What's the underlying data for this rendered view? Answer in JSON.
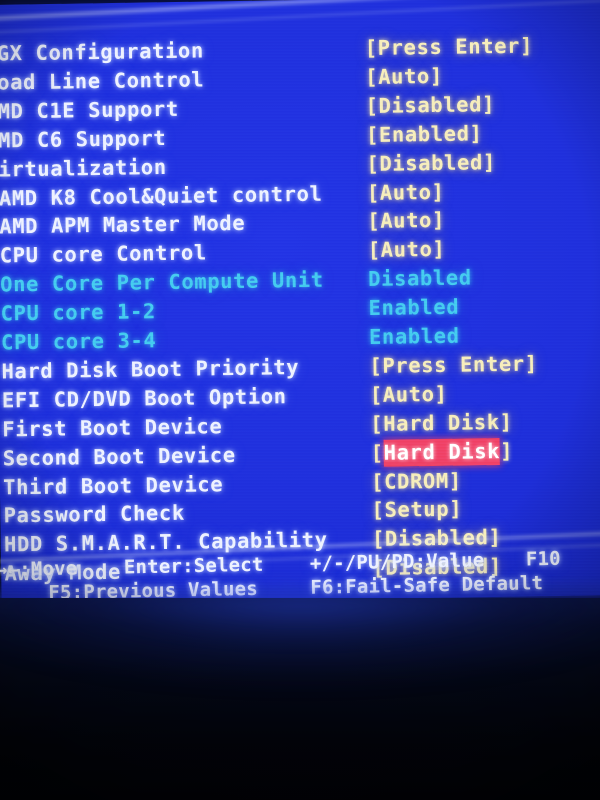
{
  "screen": {
    "kind": "bios-setup-screen",
    "background_color": "#1f2fdd",
    "text_color": "#eef2ff",
    "value_color": "#f7eebe",
    "disabled_color": "#46cdf0",
    "highlight_bg": "#f0436a",
    "highlight_fg": "#ffffff"
  },
  "menu": {
    "rows": [
      {
        "label": "GX Configuration",
        "value": "[Press Enter]",
        "state": "normal"
      },
      {
        "label": "oad Line Control",
        "value": "[Auto]",
        "state": "normal"
      },
      {
        "label": "MD C1E Support",
        "value": "[Disabled]",
        "state": "normal"
      },
      {
        "label": "MD C6 Support",
        "value": "[Enabled]",
        "state": "normal"
      },
      {
        "label": "irtualization",
        "value": "[Disabled]",
        "state": "normal"
      },
      {
        "label": "AMD K8 Cool&Quiet control",
        "value": "[Auto]",
        "state": "normal"
      },
      {
        "label": "AMD APM Master Mode",
        "value": "[Auto]",
        "state": "normal"
      },
      {
        "label": "CPU core Control",
        "value": "[Auto]",
        "state": "normal"
      },
      {
        "label": "One Core Per Compute Unit",
        "value": "Disabled",
        "state": "disabled"
      },
      {
        "label": "CPU core 1-2",
        "value": "Enabled",
        "state": "disabled"
      },
      {
        "label": "CPU core 3-4",
        "value": "Enabled",
        "state": "disabled"
      },
      {
        "label": "Hard Disk Boot Priority",
        "value": "[Press Enter]",
        "state": "normal"
      },
      {
        "label": "EFI CD/DVD Boot Option",
        "value": "[Auto]",
        "state": "normal"
      },
      {
        "label": "First Boot Device",
        "value": "[Hard Disk]",
        "state": "normal"
      },
      {
        "label": "Second Boot Device",
        "value": "[Hard Disk]",
        "state": "selected",
        "value_inner": "Hard Disk"
      },
      {
        "label": "Third Boot Device",
        "value": "[CDROM]",
        "state": "normal"
      },
      {
        "label": "Password Check",
        "value": "[Setup]",
        "state": "normal"
      },
      {
        "label": "HDD S.M.A.R.T. Capability",
        "value": "[Disabled]",
        "state": "normal"
      },
      {
        "label": "Away Mode",
        "value": "[Disabled]",
        "state": "normal"
      }
    ]
  },
  "footer": {
    "move": "→←:Move",
    "select": "Enter:Select",
    "value": "+/-/PU/PD:Value",
    "save": "F10",
    "previous": "F5:Previous Values",
    "failsafe": "F6:Fail-Safe Default"
  }
}
